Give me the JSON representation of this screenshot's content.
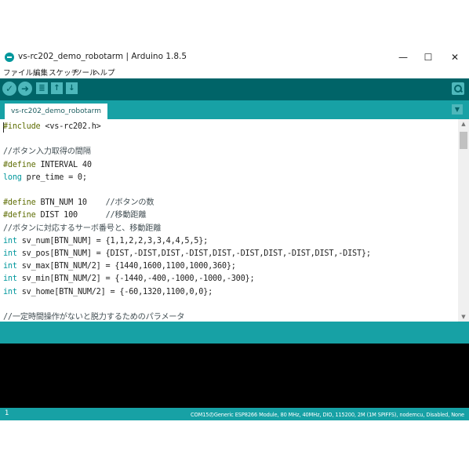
{
  "window": {
    "title": "vs-rc202_demo_robotarm | Arduino 1.8.5",
    "controls": {
      "minimize": "—",
      "maximize": "☐",
      "close": "✕"
    }
  },
  "menu": [
    "ファイル",
    "編集",
    "スケッチ",
    "ツール",
    "ヘルプ"
  ],
  "toolbar": {
    "verify_icon": "check-icon",
    "upload_icon": "arrow-right-icon",
    "new_icon": "new-file-icon",
    "open_icon": "arrow-up-icon",
    "save_icon": "arrow-down-icon",
    "serial_icon": "magnifier-icon"
  },
  "tab": {
    "label": "vs-rc202_demo_robotarm"
  },
  "code": [
    [
      {
        "t": "#include",
        "c": "kw-pre"
      },
      {
        "t": " <vs-rc202.h>"
      }
    ],
    [],
    [
      {
        "t": "//ボタン入力取得の間隔",
        "c": "comment"
      }
    ],
    [
      {
        "t": "#define",
        "c": "kw-pre"
      },
      {
        "t": " INTERVAL 40"
      }
    ],
    [
      {
        "t": "long",
        "c": "kw-type"
      },
      {
        "t": " pre_time = 0;"
      }
    ],
    [],
    [
      {
        "t": "#define",
        "c": "kw-pre"
      },
      {
        "t": " BTN_NUM 10    "
      },
      {
        "t": "//ボタンの数",
        "c": "comment"
      }
    ],
    [
      {
        "t": "#define",
        "c": "kw-pre"
      },
      {
        "t": " DIST 100      "
      },
      {
        "t": "//移動距離",
        "c": "comment"
      }
    ],
    [
      {
        "t": "//ボタンに対応するサーボ番号と、移動距離",
        "c": "comment"
      }
    ],
    [
      {
        "t": "int",
        "c": "kw-type"
      },
      {
        "t": " sv_num[BTN_NUM] = {1,1,2,2,3,3,4,4,5,5};"
      }
    ],
    [
      {
        "t": "int",
        "c": "kw-type"
      },
      {
        "t": " sv_pos[BTN_NUM] = {DIST,-DIST,DIST,-DIST,DIST,-DIST,DIST,-DIST,DIST,-DIST};"
      }
    ],
    [
      {
        "t": "int",
        "c": "kw-type"
      },
      {
        "t": " sv_max[BTN_NUM/2] = {1440,1600,1100,1000,360};"
      }
    ],
    [
      {
        "t": "int",
        "c": "kw-type"
      },
      {
        "t": " sv_min[BTN_NUM/2] = {-1440,-400,-1000,-1000,-300};"
      }
    ],
    [
      {
        "t": "int",
        "c": "kw-type"
      },
      {
        "t": " sv_home[BTN_NUM/2] = {-60,1320,1100,0,0};"
      }
    ],
    [],
    [
      {
        "t": "//一定時間操作がないと脱力するためのパラメータ",
        "c": "comment"
      }
    ]
  ],
  "status": {
    "line": "1",
    "board": "COM15のGeneric ESP8266 Module, 80 MHz, 40MHz, DIO, 115200, 2M (1M SPIFFS), nodemcu, Disabled, None"
  },
  "colors": {
    "toolbar": "#006468",
    "tabbar": "#17a1a5",
    "button": "#4db7bb",
    "console": "#000000"
  }
}
